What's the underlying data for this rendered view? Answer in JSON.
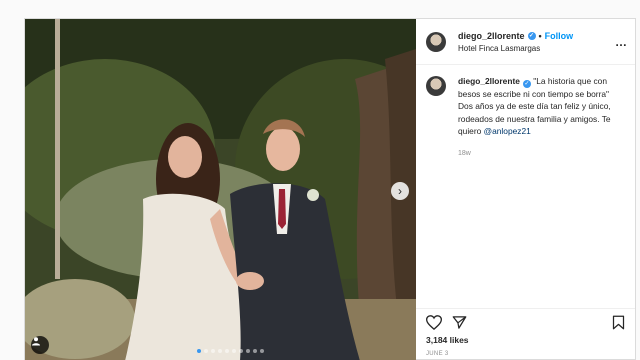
{
  "post": {
    "username": "diego_2llorente",
    "follow_label": "Follow",
    "separator": "•",
    "location": "Hotel Finca Lasmargas",
    "caption_text": "\"La historia que con besos se escribe ni con tiempo se borra\" Dos años ya de este día tan feliz y único, rodeados de nuestra familia y amigos. Te quiero",
    "mention": "@anlopez21",
    "time_ago": "18w",
    "likes": "3,184 likes",
    "date": "JUNE 3",
    "carousel_count": 10,
    "carousel_active_index": 0
  },
  "icons": {
    "more": "more-options-icon",
    "verified": "verified-badge-icon",
    "next": "chevron-right-icon",
    "tag": "user-tag-icon",
    "like": "heart-icon",
    "share": "paper-plane-icon",
    "save": "bookmark-icon"
  },
  "colors": {
    "accent": "#0095f6",
    "verified": "#3897f0",
    "mention": "#00376b",
    "muted": "#8e8e8e"
  },
  "glyphs": {
    "more": "…",
    "next": "›",
    "check": "✓"
  }
}
